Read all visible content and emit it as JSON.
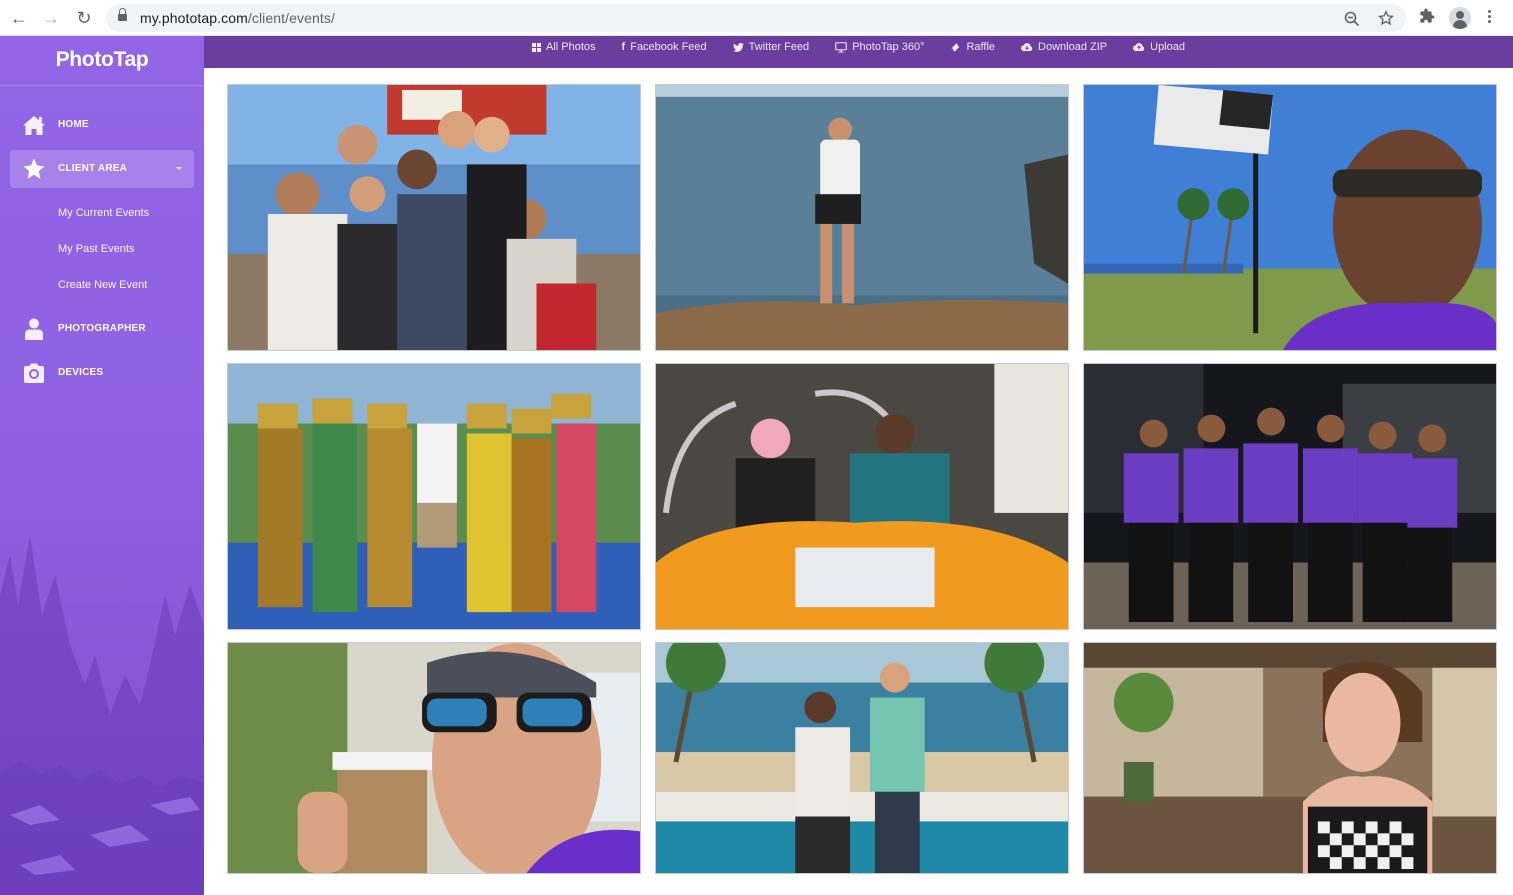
{
  "browser": {
    "url_host": "my.phototap.com",
    "url_path": "/client/events/",
    "icons": [
      "back-icon",
      "forward-icon",
      "reload-icon",
      "lock-icon",
      "zoom-out-icon",
      "bookmark-star-icon",
      "extensions-icon",
      "profile-icon",
      "menu-icon"
    ]
  },
  "sidebar": {
    "logo": "PhotoTap",
    "items": [
      {
        "label": "HOME",
        "icon": "home-icon"
      },
      {
        "label": "CLIENT AREA",
        "icon": "star-icon",
        "active": true
      },
      {
        "label": "PHOTOGRAPHER",
        "icon": "user-icon"
      },
      {
        "label": "DEVICES",
        "icon": "camera-icon"
      }
    ],
    "client_area_subitems": [
      {
        "label": "My Current Events"
      },
      {
        "label": "My Past Events"
      },
      {
        "label": "Create New Event"
      }
    ]
  },
  "topnav": {
    "items": [
      {
        "label": "All Photos",
        "icon": "grid-icon"
      },
      {
        "label": "Facebook Feed",
        "icon": "facebook-icon"
      },
      {
        "label": "Twitter Feed",
        "icon": "twitter-icon"
      },
      {
        "label": "PhotoTap 360°",
        "icon": "monitor-icon"
      },
      {
        "label": "Raffle",
        "icon": "ticket-icon"
      },
      {
        "label": "Download ZIP",
        "icon": "cloud-download-icon"
      },
      {
        "label": "Upload",
        "icon": "cloud-upload-icon"
      }
    ]
  },
  "colors": {
    "sidebar_purple": "#9364e6",
    "topbar_purple": "#6a3d9e",
    "brand_tshirt_purple": "#6a2fc9"
  },
  "gallery": {
    "photos": [
      {
        "subject": "group selfie of friends at outdoor event"
      },
      {
        "subject": "woman posing on rocks by the ocean"
      },
      {
        "subject": "man selfie on golf course with flag"
      },
      {
        "subject": "group with Balinese dancers by pool"
      },
      {
        "subject": "two people in orange vehicle with map"
      },
      {
        "subject": "team in purple PhotoTap shirts at night"
      },
      {
        "subject": "man with sunglasses holding coffee cup"
      },
      {
        "subject": "two men posing by resort pool"
      },
      {
        "subject": "smiling woman at outdoor restaurant"
      }
    ]
  }
}
